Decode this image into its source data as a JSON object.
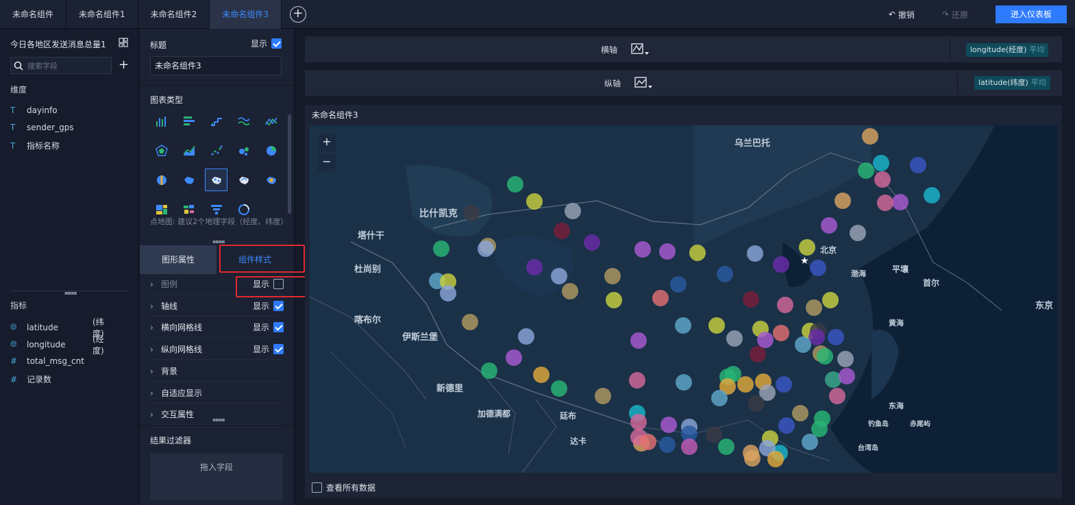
{
  "topbar": {
    "tabs": [
      {
        "label": "未命名组件",
        "active": false
      },
      {
        "label": "未命名组件1",
        "active": false
      },
      {
        "label": "未命名组件2",
        "active": false
      },
      {
        "label": "未命名组件3",
        "active": true
      }
    ],
    "undo_label": "撤销",
    "redo_label": "还原",
    "enter_dashboard_label": "进入仪表板"
  },
  "datasource": {
    "title": "今日各地区发送消息总量1",
    "search_placeholder": "搜索字段",
    "dimensions_label": "维度",
    "dimensions": [
      {
        "name": "dayinfo",
        "icon": "text-type-icon"
      },
      {
        "name": "sender_gps",
        "icon": "text-type-icon"
      },
      {
        "name": "指标名称",
        "icon": "text-type-icon"
      }
    ],
    "measures_label": "指标",
    "measures": [
      {
        "name": "latitude",
        "suffix": "(纬度)",
        "icon": "globe-icon"
      },
      {
        "name": "longitude",
        "suffix": "(经度)",
        "icon": "globe-icon"
      },
      {
        "name": "total_msg_cnt",
        "suffix": "",
        "icon": "hash-icon"
      },
      {
        "name": "记录数",
        "suffix": "",
        "icon": "hash-icon"
      }
    ]
  },
  "config": {
    "title_label": "标题",
    "show_label": "显示",
    "title_value": "未命名组件3",
    "chart_type_label": "图表类型",
    "map_hint": "点地图: 建议2个地理字段（经度、纬度）",
    "tab_graphic": "图形属性",
    "tab_component_style": "组件样式",
    "properties": [
      {
        "label": "图例",
        "show": false,
        "has_toggle": true,
        "dim": true
      },
      {
        "label": "轴线",
        "show": true,
        "has_toggle": true,
        "dim": false
      },
      {
        "label": "横向网格线",
        "show": true,
        "has_toggle": true,
        "dim": false
      },
      {
        "label": "纵向网格线",
        "show": true,
        "has_toggle": true,
        "dim": false
      },
      {
        "label": "背景",
        "has_toggle": false,
        "dim": false
      },
      {
        "label": "自适应显示",
        "has_toggle": false,
        "dim": false
      },
      {
        "label": "交互属性",
        "has_toggle": false,
        "dim": false
      }
    ],
    "result_filter_label": "结果过滤器",
    "drop_field_label": "拖入字段"
  },
  "axes": {
    "x_label": "横轴",
    "x_field": "longitude(经度)",
    "x_agg": "平均",
    "y_label": "纵轴",
    "y_field": "latitude(纬度)",
    "y_agg": "平均"
  },
  "chart": {
    "title": "未命名组件3",
    "zoom_in": "+",
    "zoom_out": "−",
    "view_all_label": "查看所有数据",
    "map_labels": [
      {
        "text": "乌兰巴托"
      },
      {
        "text": "比什凯克"
      },
      {
        "text": "塔什干"
      },
      {
        "text": "杜尚别"
      },
      {
        "text": "喀布尔"
      },
      {
        "text": "伊斯兰堡"
      },
      {
        "text": "新德里"
      },
      {
        "text": "加德满都"
      },
      {
        "text": "廷布"
      },
      {
        "text": "达卡"
      },
      {
        "text": "北京"
      },
      {
        "text": "渤海"
      },
      {
        "text": "平壤"
      },
      {
        "text": "首尔"
      },
      {
        "text": "东京"
      },
      {
        "text": "黄海"
      },
      {
        "text": "东海"
      },
      {
        "text": "钓鱼岛"
      },
      {
        "text": "赤尾屿"
      },
      {
        "text": "台湾岛"
      }
    ],
    "points_count_hint": "",
    "palette": [
      "#d9a35f",
      "#1bb6c9",
      "#d4699a",
      "#3b57c4",
      "#a95ad1",
      "#d6c23a",
      "#2ab675",
      "#c8cf3e",
      "#9aa3b5",
      "#7a1f3a",
      "#6a2ca8",
      "#8aa6d8",
      "#2a5aa0",
      "#5fa7c9",
      "#e07070",
      "#e0a93a",
      "#3aaa8a",
      "#c25bb5",
      "#b09a60",
      "#3a3a44"
    ]
  },
  "colors": {
    "accent": "#2e7bff",
    "highlight_box": "#e0282e",
    "pill_bg": "#0f4a5a"
  }
}
